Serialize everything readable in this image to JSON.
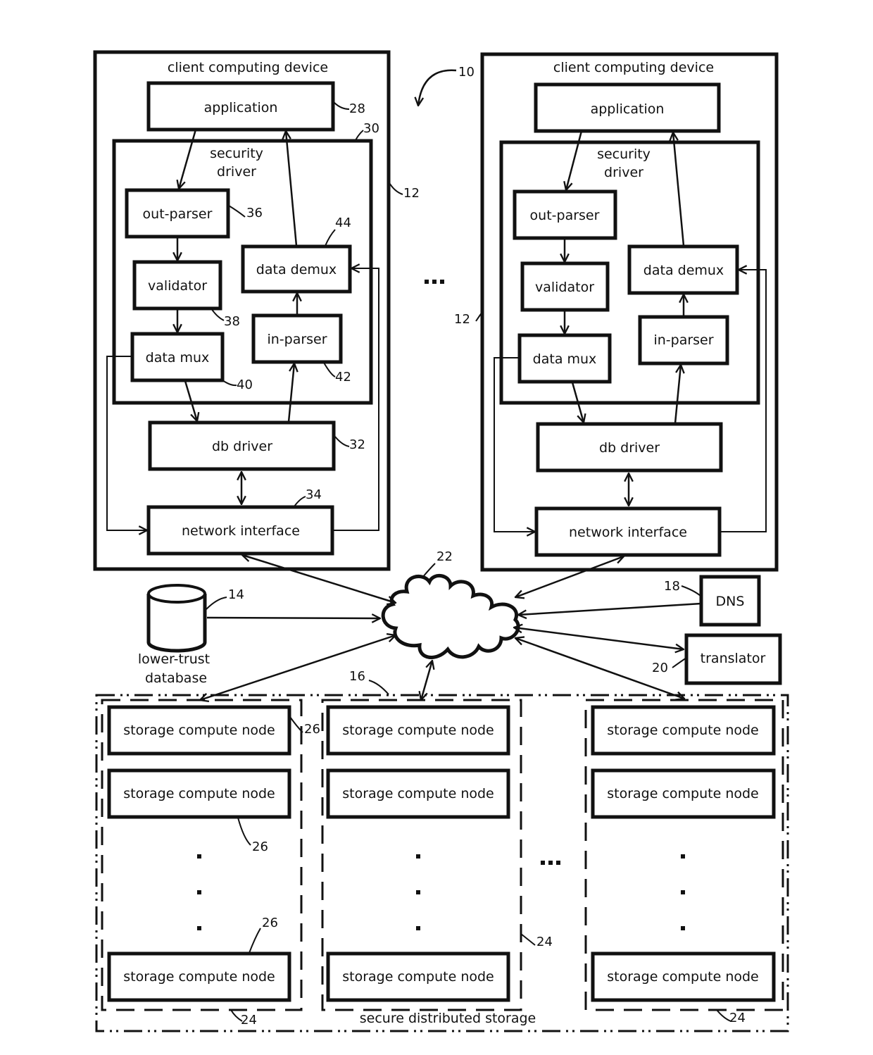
{
  "figure": {
    "system_ref": "10",
    "ellipsis": "...",
    "devices": [
      {
        "title": "client computing device",
        "ref": "12",
        "application": {
          "label": "application",
          "ref": "28"
        },
        "security_driver": {
          "label_line1": "security",
          "label_line2": "driver",
          "ref": "30"
        },
        "out_parser": {
          "label": "out-parser",
          "ref": "36"
        },
        "validator": {
          "label": "validator",
          "ref": "38"
        },
        "data_mux": {
          "label": "data mux",
          "ref": "40"
        },
        "in_parser": {
          "label": "in-parser",
          "ref": "42"
        },
        "data_demux": {
          "label": "data demux",
          "ref": "44"
        },
        "db_driver": {
          "label": "db driver",
          "ref": "32"
        },
        "network_interface": {
          "label": "network interface",
          "ref": "34"
        }
      },
      {
        "title": "client computing device",
        "ref": "12",
        "application": {
          "label": "application"
        },
        "security_driver": {
          "label_line1": "security",
          "label_line2": "driver"
        },
        "out_parser": {
          "label": "out-parser"
        },
        "validator": {
          "label": "validator"
        },
        "data_mux": {
          "label": "data mux"
        },
        "in_parser": {
          "label": "in-parser"
        },
        "data_demux": {
          "label": "data demux"
        },
        "db_driver": {
          "label": "db driver"
        },
        "network_interface": {
          "label": "network interface"
        }
      }
    ],
    "network": {
      "ref": "22"
    },
    "database": {
      "label_line1": "lower-trust",
      "label_line2": "database",
      "ref": "14"
    },
    "dns": {
      "label": "DNS",
      "ref": "18"
    },
    "translator": {
      "label": "translator",
      "ref": "20"
    },
    "storage": {
      "label": "secure distributed storage",
      "ref": "16",
      "group_ref": "24",
      "node_ref": "26",
      "node_label": "storage compute node",
      "vertical_dots": "•"
    }
  }
}
